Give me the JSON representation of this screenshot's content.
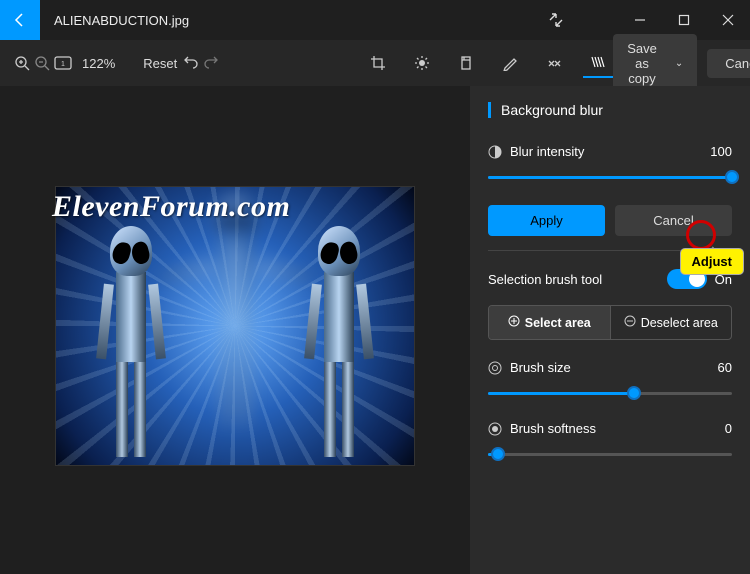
{
  "titlebar": {
    "filename": "ALIENABDUCTION.jpg"
  },
  "toolbar": {
    "zoom": "122%",
    "reset": "Reset",
    "save_as": "Save as copy",
    "cancel": "Cancel"
  },
  "watermark": "ElevenForum.com",
  "panel": {
    "title": "Background blur",
    "blur_intensity": {
      "label": "Blur intensity",
      "value": "100",
      "percent": 100
    },
    "apply": "Apply",
    "cancel": "Cancel",
    "brush_tool": {
      "label": "Selection brush tool",
      "on_label": "On"
    },
    "select_area": "Select area",
    "deselect_area": "Deselect area",
    "brush_size": {
      "label": "Brush size",
      "value": "60",
      "percent": 60
    },
    "brush_softness": {
      "label": "Brush softness",
      "value": "0",
      "percent": 4
    }
  },
  "annotation": {
    "label": "Adjust"
  }
}
